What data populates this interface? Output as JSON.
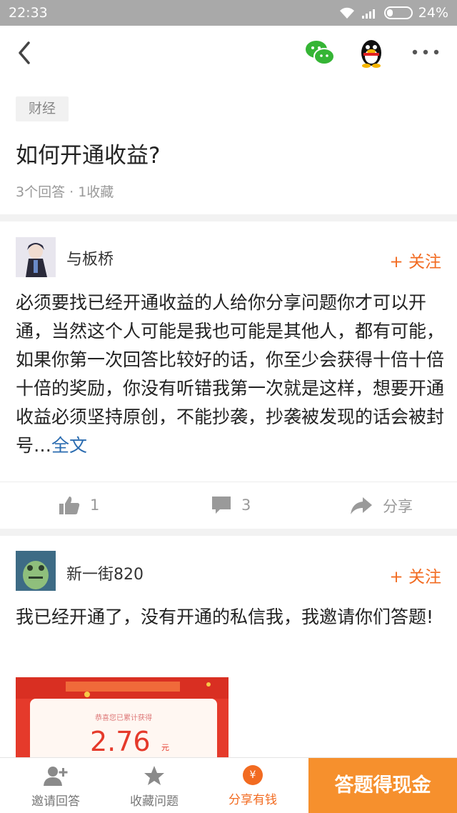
{
  "status_bar": {
    "time": "22:33",
    "battery": "24%"
  },
  "question": {
    "tag": "财经",
    "title": "如何开通收益?",
    "meta": "3个回答 · 1收藏"
  },
  "answers": [
    {
      "author": "与板桥",
      "follow_label": "+ 关注",
      "text": "必须要找已经开通收益的人给你分享问题你才可以开通，当然这个人可能是我也可能是其他人，都有可能，如果你第一次回答比较好的话，你至少会获得十倍十倍十倍的奖励，你没有听错我第一次就是这样，想要开通收益必须坚持原创，不能抄袭，抄袭被发现的话会被封号…",
      "full_text_link": "全文",
      "likes": "1",
      "comments": "3",
      "share_label": "分享"
    },
    {
      "author": "新一街820",
      "follow_label": "+ 关注",
      "text": "我已经开通了，没有开通的私信我，我邀请你们答题!",
      "image_label": "恭喜您已累计获得",
      "image_amount": "2.76",
      "image_unit": "元"
    }
  ],
  "bottom_bar": {
    "tabs": [
      {
        "label": "邀请回答",
        "icon": "add-user-icon"
      },
      {
        "label": "收藏问题",
        "icon": "star-icon"
      },
      {
        "label": "分享有钱",
        "icon": "yuan-badge-icon",
        "badge": "¥"
      }
    ],
    "cta_label": "答题得现金"
  },
  "colors": {
    "accent": "#f26b21",
    "link": "#2b6cb0",
    "status_bar": "#a9a9a9",
    "cta": "#f6902d"
  }
}
